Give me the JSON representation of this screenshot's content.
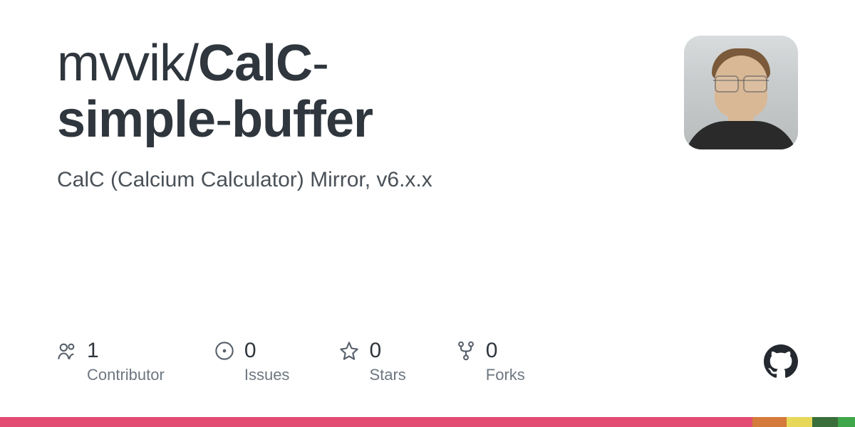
{
  "repo": {
    "owner": "mvvik",
    "slash": "/",
    "name_part1": "CalC",
    "name_dash1": "-",
    "name_part2": "simple",
    "name_dash2": "-",
    "name_part3": "buffer"
  },
  "description": "CalC (Calcium Calculator) Mirror, v6.x.x",
  "stats": {
    "contributors": {
      "value": "1",
      "label": "Contributor"
    },
    "issues": {
      "value": "0",
      "label": "Issues"
    },
    "stars": {
      "value": "0",
      "label": "Stars"
    },
    "forks": {
      "value": "0",
      "label": "Forks"
    }
  }
}
